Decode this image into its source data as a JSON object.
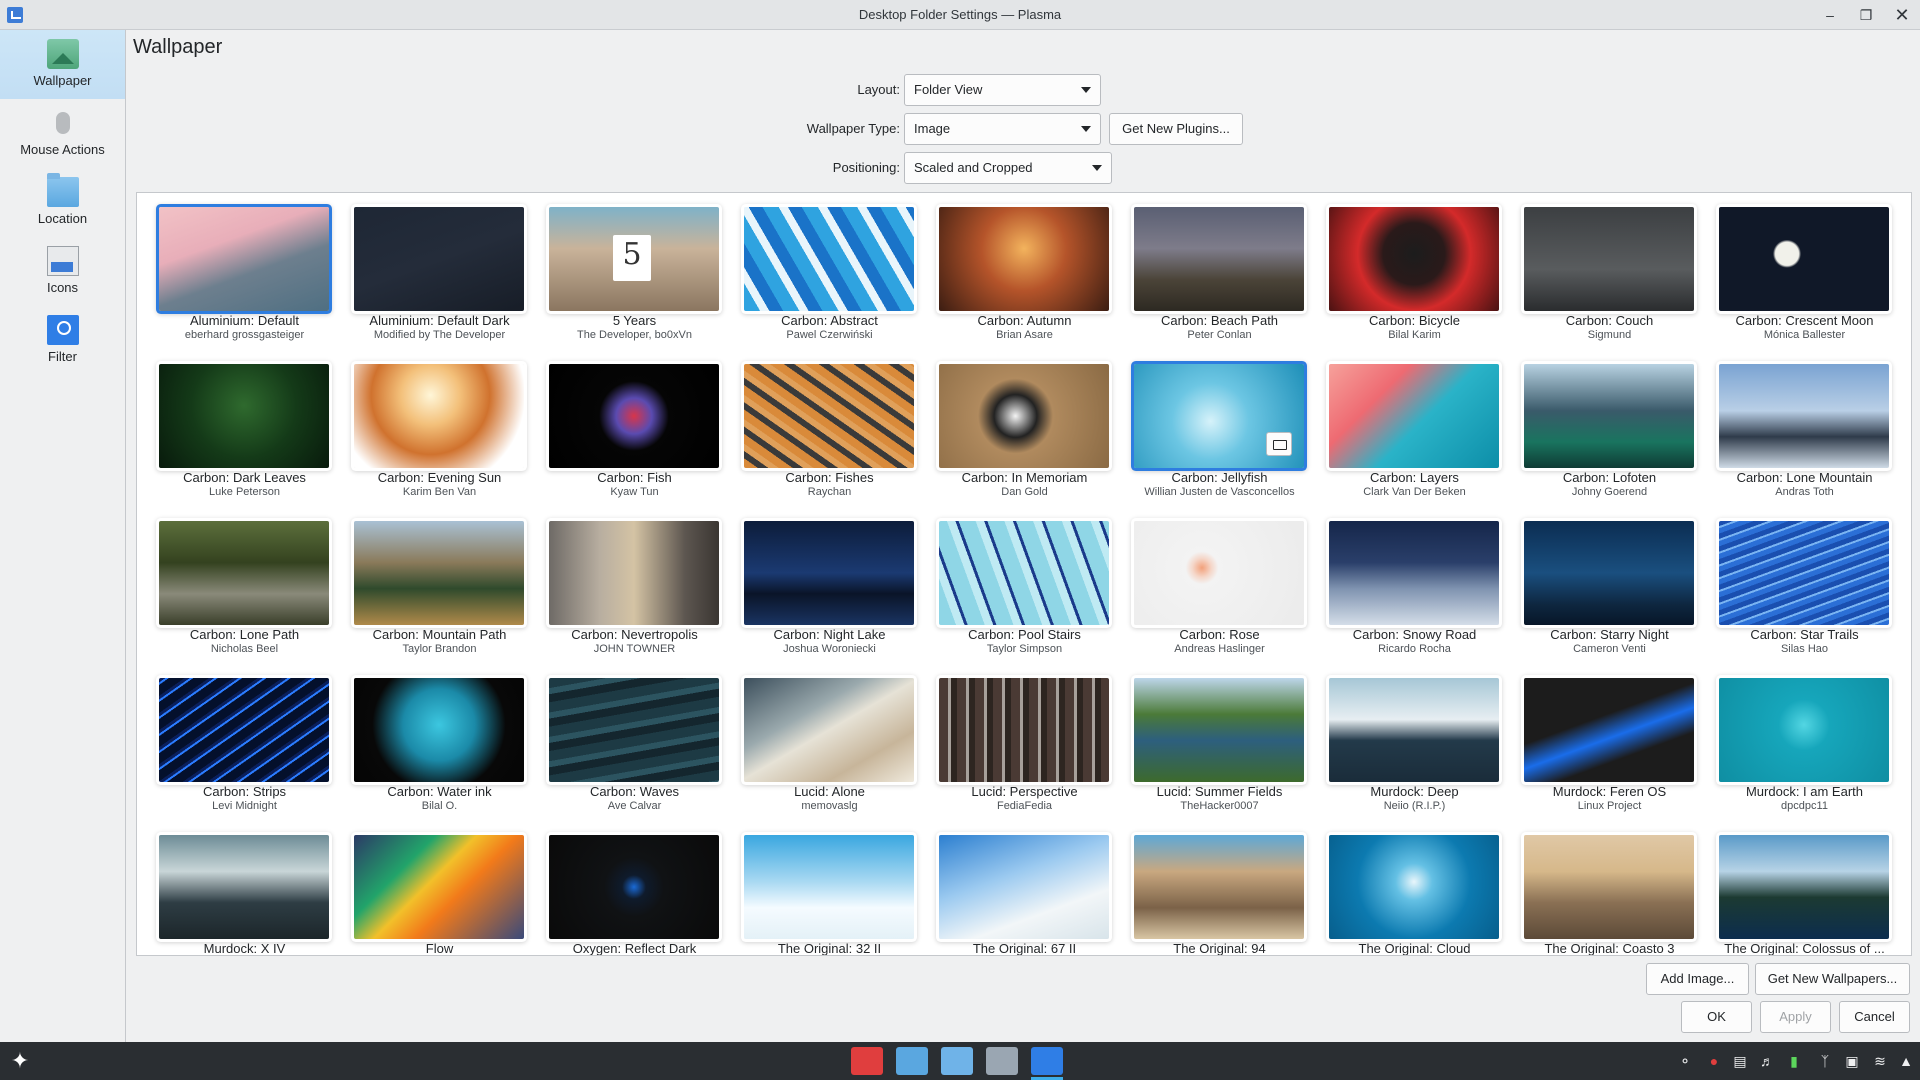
{
  "window": {
    "title": "Desktop Folder Settings — Plasma"
  },
  "sidebar": {
    "items": [
      {
        "label": "Wallpaper",
        "icon": "wallpaper-icon"
      },
      {
        "label": "Mouse Actions",
        "icon": "mouse-icon"
      },
      {
        "label": "Location",
        "icon": "folder-icon"
      },
      {
        "label": "Icons",
        "icon": "icons-icon"
      },
      {
        "label": "Filter",
        "icon": "filter-icon"
      }
    ]
  },
  "page_title": "Wallpaper",
  "form": {
    "layout_label": "Layout:",
    "layout_value": "Folder View",
    "type_label": "Wallpaper Type:",
    "type_value": "Image",
    "get_plugins": "Get New Plugins...",
    "positioning_label": "Positioning:",
    "positioning_value": "Scaled and Cropped"
  },
  "wallpapers": [
    {
      "name": "Aluminium: Default",
      "author": "eberhard grossgasteiger",
      "bg": "linear-gradient(160deg,#f2c2c6 0%,#e8aeb9 35%,#6d7f8e 60%,#4f6f82 100%)"
    },
    {
      "name": "Aluminium: Default Dark",
      "author": "Modified by The Developer",
      "bg": "linear-gradient(160deg,#1e2735 0%,#242c3a 50%,#171d27 100%)"
    },
    {
      "name": "5 Years",
      "author": "The Developer, bo0xVn",
      "bg": "linear-gradient(180deg,#7fb2c8 0%,#c9b39a 40%,#8b7660 100%)"
    },
    {
      "name": "Carbon: Abstract",
      "author": "Pawel Czerwiński",
      "bg": "repeating-linear-gradient(60deg,#2fa3e0 0 14px,#e9f5fb 14px 22px,#1a73c8 22px 34px)"
    },
    {
      "name": "Carbon: Autumn",
      "author": "Brian Asare",
      "bg": "radial-gradient(circle at 50% 40%,#f3b35d 0%,#b5542a 40%,#3b1d12 100%)"
    },
    {
      "name": "Carbon: Beach Path",
      "author": "Peter Conlan",
      "bg": "linear-gradient(180deg,#5a5f73 0%,#7e7c8a 40%,#4b4438 70%,#2d2922 100%)"
    },
    {
      "name": "Carbon: Bicycle",
      "author": "Bilal Karim",
      "bg": "radial-gradient(circle at 50% 45%,#1c1c1c 0%,#2a1a1a 30%,#d42a2a 55%,#4a1212 100%)"
    },
    {
      "name": "Carbon: Couch",
      "author": "Sigmund",
      "bg": "linear-gradient(180deg,#3c3f42 0%,#595c5e 60%,#2a2c2e 100%)"
    },
    {
      "name": "Carbon: Crescent Moon",
      "author": "Mónica Ballester",
      "bg": "radial-gradient(circle at 40% 45%,#f1f1ea 0%,#f1f1ea 10%,#101828 12%,#101828 100%)"
    },
    {
      "name": "Carbon: Dark Leaves",
      "author": "Luke Peterson",
      "bg": "radial-gradient(circle at 50% 40%,#2f6a2e 0%,#143a18 50%,#081a0c 100%)"
    },
    {
      "name": "Carbon: Evening Sun",
      "author": "Karim Ben Van",
      "bg": "radial-gradient(circle at 45% 30%,#fff6d8 0%,#f3c07a 25%,#d0722e 50%,#ffffff 80%)"
    },
    {
      "name": "Carbon: Fish",
      "author": "Kyaw Tun",
      "bg": "radial-gradient(circle at 50% 50%,#d8354a 0%,#5a4bb0 18%,#050505 35%,#000000 100%)"
    },
    {
      "name": "Carbon: Fishes",
      "author": "Raychan",
      "bg": "repeating-linear-gradient(35deg,#d98a3a 0 8px,#3a3a3a 8px 14px,#e0a05a 14px 20px)"
    },
    {
      "name": "Carbon: In Memoriam",
      "author": "Dan Gold",
      "bg": "radial-gradient(circle at 45% 50%,#f4f4f4 0%,#222 20%,#b08a5e 35%,#8a6a44 100%)"
    },
    {
      "name": "Carbon: Jellyfish",
      "author": "Willian Justen de Vasconcellos",
      "bg": "radial-gradient(circle at 45% 55%,#d6f2fa 0%,#6cc6e3 35%,#1e8fb8 100%)"
    },
    {
      "name": "Carbon: Layers",
      "author": "Clark Van Der Beken",
      "bg": "linear-gradient(135deg,#f6a19b 0%,#ee6a72 30%,#2ab3c8 55%,#0d8ea8 100%)"
    },
    {
      "name": "Carbon: Lofoten",
      "author": "Johny Goerend",
      "bg": "linear-gradient(180deg,#b8d2e2 0%,#3a5a6a 45%,#19745f 75%,#0f3b34 100%)"
    },
    {
      "name": "Carbon: Lone Mountain",
      "author": "Andras Toth",
      "bg": "linear-gradient(180deg,#7aa3d2 0%,#b9cfe6 45%,#2f3b4a 70%,#cfdbe6 100%)"
    },
    {
      "name": "Carbon: Lone Path",
      "author": "Nicholas Beel",
      "bg": "linear-gradient(180deg,#5c6f3c 0%,#34421f 40%,#8a8a7a 70%,#3a3f2a 100%)"
    },
    {
      "name": "Carbon: Mountain Path",
      "author": "Taylor Brandon",
      "bg": "linear-gradient(180deg,#a9c1d4 0%,#8a7a5a 40%,#2f4a2c 65%,#b08a4a 100%)"
    },
    {
      "name": "Carbon: Nevertropolis",
      "author": "JOHN TOWNER",
      "bg": "linear-gradient(90deg,#6e6a66 0%,#b8aea0 30%,#d4c3a4 50%,#5d5650 80%,#3a3632 100%)"
    },
    {
      "name": "Carbon: Night Lake",
      "author": "Joshua Woroniecki",
      "bg": "linear-gradient(180deg,#0c1c3a 0%,#1b3a72 50%,#0a1428 70%,#1a3462 100%)"
    },
    {
      "name": "Carbon: Pool Stairs",
      "author": "Taylor Simpson",
      "bg": "repeating-linear-gradient(70deg,#8fd6e6 0 16px,#bfeaf3 16px 24px,#1a3a8a 24px 27px)"
    },
    {
      "name": "Carbon: Rose",
      "author": "Andreas Haslinger",
      "bg": "radial-gradient(circle at 40% 45%,#f2a07a 0%,#f5d6c8 8%,#f3f3f3 14%,#ebebeb 100%)"
    },
    {
      "name": "Carbon: Snowy Road",
      "author": "Ricardo Rocha",
      "bg": "linear-gradient(180deg,#15264a 0%,#2a3f6a 40%,#7f93b0 65%,#d4dde8 100%)"
    },
    {
      "name": "Carbon: Starry Night",
      "author": "Cameron Venti",
      "bg": "linear-gradient(180deg,#0b2d52 0%,#1a4f7f 50%,#0e2740 80%,#071628 100%)"
    },
    {
      "name": "Carbon: Star Trails",
      "author": "Silas Hao",
      "bg": "repeating-linear-gradient(-20deg,#2b6fd6 0 5px,#7ab4f2 5px 7px,#1a4fb0 7px 12px)"
    },
    {
      "name": "Carbon: Strips",
      "author": "Levi Midnight",
      "bg": "repeating-linear-gradient(-35deg,#04102c 0 9px,#2b7cff 9px 11px,#0a1f5c 11px 14px)"
    },
    {
      "name": "Carbon: Water ink",
      "author": "Bilal O.",
      "bg": "radial-gradient(circle at 50% 45%,#3cc7e0 0%,#1b8aa8 35%,#080808 65%,#050505 100%)"
    },
    {
      "name": "Carbon: Waves",
      "author": "Ave Calvar",
      "bg": "repeating-linear-gradient(170deg,#1d3a44 0 10px,#2c5460 10px 16px,#14262e 16px 24px)"
    },
    {
      "name": "Lucid: Alone",
      "author": "memovaslg",
      "bg": "linear-gradient(150deg,#3c4f5c 0%,#9aa9ad 35%,#e6e2d6 50%,#c7b59a 75%,#efe9dc 100%)"
    },
    {
      "name": "Lucid: Perspective",
      "author": "FediaFedia",
      "bg": "repeating-linear-gradient(90deg,#4a3a34 0 9px,#a7a09a 9px 12px,#2d2520 12px 18px)"
    },
    {
      "name": "Lucid: Summer Fields",
      "author": "TheHacker0007",
      "bg": "linear-gradient(180deg,#bdd6ea 0%,#4b7a38 35%,#2d5f7e 60%,#3d6a2c 100%)"
    },
    {
      "name": "Murdock: Deep",
      "author": "Neiio (R.I.P.)",
      "bg": "linear-gradient(180deg,#a6c7d6 0%,#e7eef2 40%,#233a4a 60%,#1a2c3a 100%)"
    },
    {
      "name": "Murdock: Feren OS",
      "author": "Linux Project",
      "bg": "linear-gradient(160deg,#1c1c1c 0%,#1c1c1c 40%,#1a6dea 55%,#1c1c1c 70%)"
    },
    {
      "name": "Murdock: I am Earth",
      "author": "dpcdpc11",
      "bg": "radial-gradient(circle at 50% 45%,#53d6e3 0%,#16a6bb 25%,#0f8ea2 100%)"
    },
    {
      "name": "Murdock: X IV",
      "author": "",
      "bg": "linear-gradient(180deg,#6d8c96 0%,#c9d6d8 35%,#2e3d44 65%,#1c262a 100%)"
    },
    {
      "name": "Flow",
      "author": "",
      "bg": "linear-gradient(135deg,#2b3a66 0%,#22a46a 30%,#f2c02a 45%,#f27a1a 60%,#3a4a7a 100%)"
    },
    {
      "name": "Oxygen: Reflect Dark",
      "author": "",
      "bg": "radial-gradient(circle at 50% 50%,#1a6ad6 0%,#0f1b2c 12%,#101214 30%,#0a0a0a 100%)"
    },
    {
      "name": "The Original: 32 II",
      "author": "",
      "bg": "linear-gradient(180deg,#3aa7e0 0%,#a9d9f2 45%,#f5fbff 70%,#e4f1f7 100%)"
    },
    {
      "name": "The Original: 67 II",
      "author": "",
      "bg": "linear-gradient(160deg,#2c7fd0 0%,#9ccaf0 40%,#f2f6f8 70%,#d8e4ea 100%)"
    },
    {
      "name": "The Original: 94",
      "author": "",
      "bg": "linear-gradient(180deg,#5ea8d6 0%,#c9a880 35%,#7b6248 70%,#d9c6a4 100%)"
    },
    {
      "name": "The Original: Cloud",
      "author": "",
      "bg": "radial-gradient(circle at 50% 45%,#e9f6fb 0%,#64c0e4 18%,#0c7ab0 55%,#075e8c 100%)"
    },
    {
      "name": "The Original: Coasto 3",
      "author": "",
      "bg": "linear-gradient(180deg,#e0c8a6 0%,#d6b88a 35%,#8a7054 65%,#5c4a38 100%)"
    },
    {
      "name": "The Original: Colossus of ...",
      "author": "",
      "bg": "linear-gradient(180deg,#5a9ac8 0%,#b7d3e6 35%,#1c3a32 60%,#0c2d4e 100%)"
    }
  ],
  "buttons": {
    "add_image": "Add Image...",
    "get_wallpapers": "Get New Wallpapers...",
    "ok": "OK",
    "apply": "Apply",
    "cancel": "Cancel"
  },
  "colors": {
    "accent": "#2e7de0",
    "taskbar": "#2a2e32"
  }
}
